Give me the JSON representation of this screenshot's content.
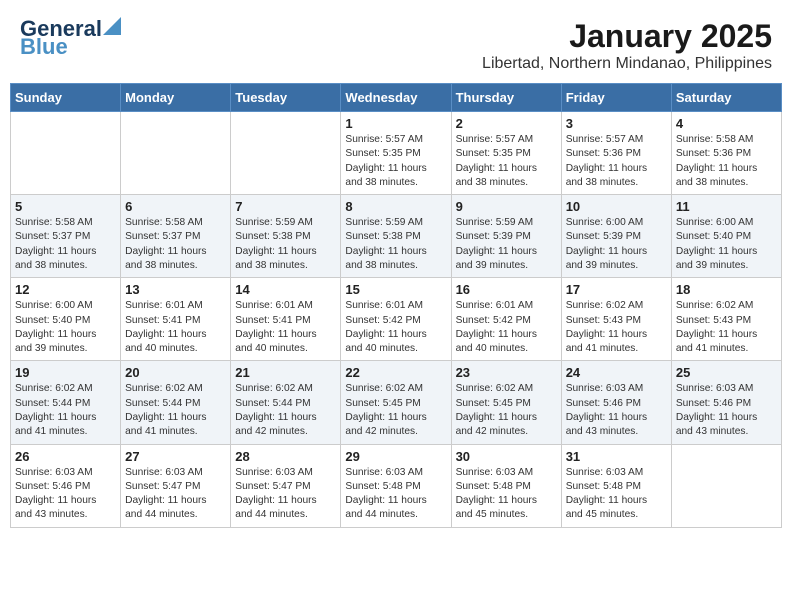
{
  "header": {
    "logo_line1": "General",
    "logo_line2": "Blue",
    "title": "January 2025",
    "subtitle": "Libertad, Northern Mindanao, Philippines"
  },
  "weekdays": [
    "Sunday",
    "Monday",
    "Tuesday",
    "Wednesday",
    "Thursday",
    "Friday",
    "Saturday"
  ],
  "weeks": [
    [
      {
        "day": "",
        "sunrise": "",
        "sunset": "",
        "daylight": ""
      },
      {
        "day": "",
        "sunrise": "",
        "sunset": "",
        "daylight": ""
      },
      {
        "day": "",
        "sunrise": "",
        "sunset": "",
        "daylight": ""
      },
      {
        "day": "1",
        "sunrise": "Sunrise: 5:57 AM",
        "sunset": "Sunset: 5:35 PM",
        "daylight": "Daylight: 11 hours and 38 minutes."
      },
      {
        "day": "2",
        "sunrise": "Sunrise: 5:57 AM",
        "sunset": "Sunset: 5:35 PM",
        "daylight": "Daylight: 11 hours and 38 minutes."
      },
      {
        "day": "3",
        "sunrise": "Sunrise: 5:57 AM",
        "sunset": "Sunset: 5:36 PM",
        "daylight": "Daylight: 11 hours and 38 minutes."
      },
      {
        "day": "4",
        "sunrise": "Sunrise: 5:58 AM",
        "sunset": "Sunset: 5:36 PM",
        "daylight": "Daylight: 11 hours and 38 minutes."
      }
    ],
    [
      {
        "day": "5",
        "sunrise": "Sunrise: 5:58 AM",
        "sunset": "Sunset: 5:37 PM",
        "daylight": "Daylight: 11 hours and 38 minutes."
      },
      {
        "day": "6",
        "sunrise": "Sunrise: 5:58 AM",
        "sunset": "Sunset: 5:37 PM",
        "daylight": "Daylight: 11 hours and 38 minutes."
      },
      {
        "day": "7",
        "sunrise": "Sunrise: 5:59 AM",
        "sunset": "Sunset: 5:38 PM",
        "daylight": "Daylight: 11 hours and 38 minutes."
      },
      {
        "day": "8",
        "sunrise": "Sunrise: 5:59 AM",
        "sunset": "Sunset: 5:38 PM",
        "daylight": "Daylight: 11 hours and 38 minutes."
      },
      {
        "day": "9",
        "sunrise": "Sunrise: 5:59 AM",
        "sunset": "Sunset: 5:39 PM",
        "daylight": "Daylight: 11 hours and 39 minutes."
      },
      {
        "day": "10",
        "sunrise": "Sunrise: 6:00 AM",
        "sunset": "Sunset: 5:39 PM",
        "daylight": "Daylight: 11 hours and 39 minutes."
      },
      {
        "day": "11",
        "sunrise": "Sunrise: 6:00 AM",
        "sunset": "Sunset: 5:40 PM",
        "daylight": "Daylight: 11 hours and 39 minutes."
      }
    ],
    [
      {
        "day": "12",
        "sunrise": "Sunrise: 6:00 AM",
        "sunset": "Sunset: 5:40 PM",
        "daylight": "Daylight: 11 hours and 39 minutes."
      },
      {
        "day": "13",
        "sunrise": "Sunrise: 6:01 AM",
        "sunset": "Sunset: 5:41 PM",
        "daylight": "Daylight: 11 hours and 40 minutes."
      },
      {
        "day": "14",
        "sunrise": "Sunrise: 6:01 AM",
        "sunset": "Sunset: 5:41 PM",
        "daylight": "Daylight: 11 hours and 40 minutes."
      },
      {
        "day": "15",
        "sunrise": "Sunrise: 6:01 AM",
        "sunset": "Sunset: 5:42 PM",
        "daylight": "Daylight: 11 hours and 40 minutes."
      },
      {
        "day": "16",
        "sunrise": "Sunrise: 6:01 AM",
        "sunset": "Sunset: 5:42 PM",
        "daylight": "Daylight: 11 hours and 40 minutes."
      },
      {
        "day": "17",
        "sunrise": "Sunrise: 6:02 AM",
        "sunset": "Sunset: 5:43 PM",
        "daylight": "Daylight: 11 hours and 41 minutes."
      },
      {
        "day": "18",
        "sunrise": "Sunrise: 6:02 AM",
        "sunset": "Sunset: 5:43 PM",
        "daylight": "Daylight: 11 hours and 41 minutes."
      }
    ],
    [
      {
        "day": "19",
        "sunrise": "Sunrise: 6:02 AM",
        "sunset": "Sunset: 5:44 PM",
        "daylight": "Daylight: 11 hours and 41 minutes."
      },
      {
        "day": "20",
        "sunrise": "Sunrise: 6:02 AM",
        "sunset": "Sunset: 5:44 PM",
        "daylight": "Daylight: 11 hours and 41 minutes."
      },
      {
        "day": "21",
        "sunrise": "Sunrise: 6:02 AM",
        "sunset": "Sunset: 5:44 PM",
        "daylight": "Daylight: 11 hours and 42 minutes."
      },
      {
        "day": "22",
        "sunrise": "Sunrise: 6:02 AM",
        "sunset": "Sunset: 5:45 PM",
        "daylight": "Daylight: 11 hours and 42 minutes."
      },
      {
        "day": "23",
        "sunrise": "Sunrise: 6:02 AM",
        "sunset": "Sunset: 5:45 PM",
        "daylight": "Daylight: 11 hours and 42 minutes."
      },
      {
        "day": "24",
        "sunrise": "Sunrise: 6:03 AM",
        "sunset": "Sunset: 5:46 PM",
        "daylight": "Daylight: 11 hours and 43 minutes."
      },
      {
        "day": "25",
        "sunrise": "Sunrise: 6:03 AM",
        "sunset": "Sunset: 5:46 PM",
        "daylight": "Daylight: 11 hours and 43 minutes."
      }
    ],
    [
      {
        "day": "26",
        "sunrise": "Sunrise: 6:03 AM",
        "sunset": "Sunset: 5:46 PM",
        "daylight": "Daylight: 11 hours and 43 minutes."
      },
      {
        "day": "27",
        "sunrise": "Sunrise: 6:03 AM",
        "sunset": "Sunset: 5:47 PM",
        "daylight": "Daylight: 11 hours and 44 minutes."
      },
      {
        "day": "28",
        "sunrise": "Sunrise: 6:03 AM",
        "sunset": "Sunset: 5:47 PM",
        "daylight": "Daylight: 11 hours and 44 minutes."
      },
      {
        "day": "29",
        "sunrise": "Sunrise: 6:03 AM",
        "sunset": "Sunset: 5:48 PM",
        "daylight": "Daylight: 11 hours and 44 minutes."
      },
      {
        "day": "30",
        "sunrise": "Sunrise: 6:03 AM",
        "sunset": "Sunset: 5:48 PM",
        "daylight": "Daylight: 11 hours and 45 minutes."
      },
      {
        "day": "31",
        "sunrise": "Sunrise: 6:03 AM",
        "sunset": "Sunset: 5:48 PM",
        "daylight": "Daylight: 11 hours and 45 minutes."
      },
      {
        "day": "",
        "sunrise": "",
        "sunset": "",
        "daylight": ""
      }
    ]
  ]
}
